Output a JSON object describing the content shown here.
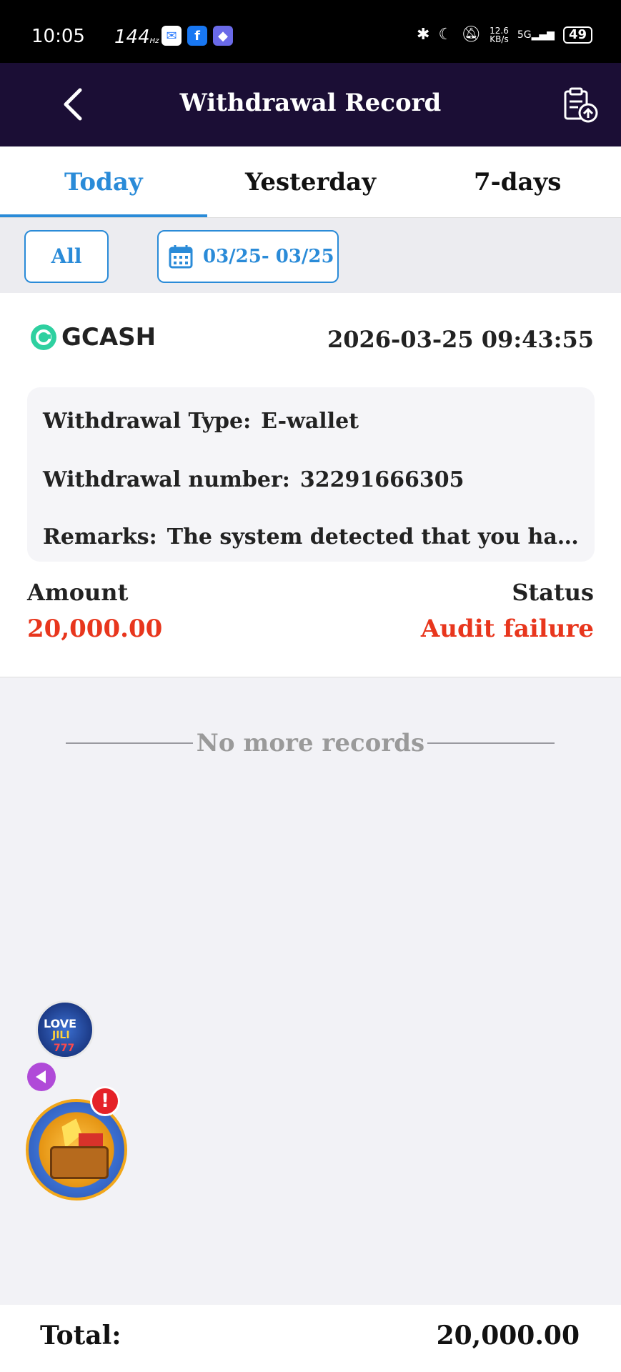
{
  "status_bar": {
    "time": "10:05",
    "refresh": "144",
    "refresh_unit": "Hz",
    "speed": "12.6",
    "speed_unit": "KB/s",
    "network": "5G",
    "battery": "49"
  },
  "header": {
    "title": "Withdrawal Record",
    "back_icon": "chevron-left-icon",
    "action_icon": "clipboard-upload-icon"
  },
  "tabs": [
    {
      "label": "Today",
      "active": true
    },
    {
      "label": "Yesterday",
      "active": false
    },
    {
      "label": "7-days",
      "active": false
    }
  ],
  "filters": {
    "all_label": "All",
    "date_range": "03/25- 03/25"
  },
  "record": {
    "method": "GCASH",
    "timestamp": "2026-03-25 09:43:55",
    "type_label": "Withdrawal Type:",
    "type_value": "E-wallet",
    "number_label": "Withdrawal number:",
    "number_value": "32291666305",
    "remarks_label": "Remarks:",
    "remarks_value": "The system detected that you hav...",
    "amount_label": "Amount",
    "amount_value": "20,000.00",
    "status_label": "Status",
    "status_value": "Audit failure"
  },
  "list_end": "No more records",
  "floating": {
    "love_line1": "LOVE",
    "love_line2": "JILI",
    "love_line3": "777",
    "alert": "!"
  },
  "footer": {
    "total_label": "Total:",
    "total_value": "20,000.00"
  },
  "colors": {
    "header_bg": "#1b0e35",
    "accent": "#2a8bd8",
    "danger": "#e8361d"
  }
}
